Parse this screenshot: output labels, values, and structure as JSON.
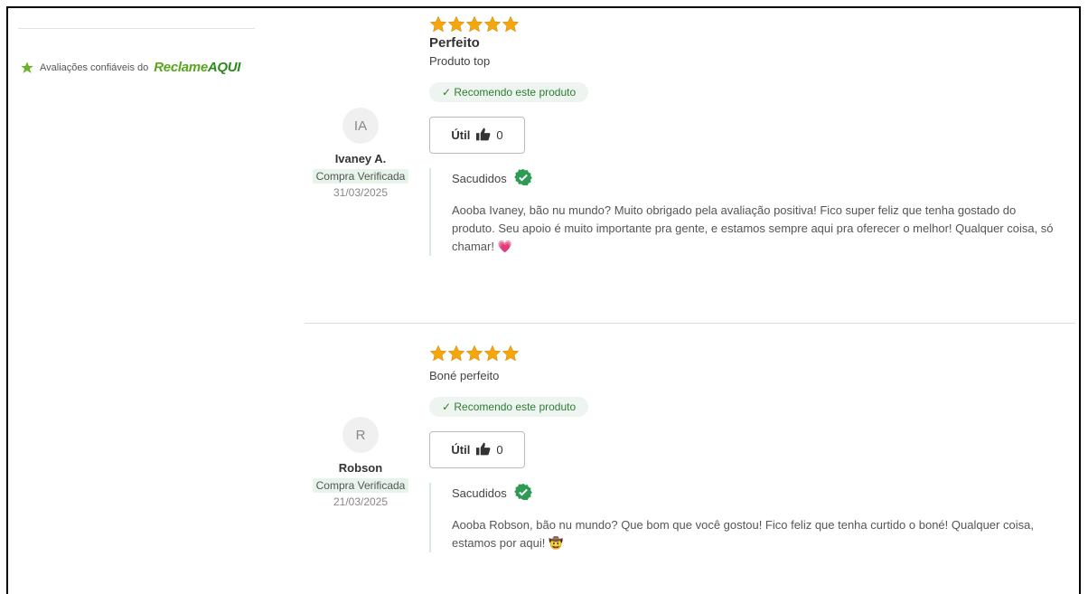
{
  "sidebar": {
    "badge_text": "Avaliações confiáveis do",
    "logo_part1": "Reclame",
    "logo_part2": "AQUI"
  },
  "colors": {
    "star": "#f4a70a",
    "recommend_green": "#2e7d32",
    "verified_bg": "#e6f4ea",
    "check_badge": "#2e9b54"
  },
  "reviews": [
    {
      "initials": "IA",
      "author": "Ivaney A.",
      "verified": "Compra Verificada",
      "date": "31/03/2025",
      "rating": 5,
      "title": "Perfeito",
      "body": "Produto top",
      "recommend": "✓ Recomendo este produto",
      "useful_label": "Útil",
      "useful_count": "0",
      "reply_author": "Sacudidos",
      "reply_text": "Aooba Ivaney, bão nu mundo? Muito obrigado pela avaliação positiva! Fico super feliz que tenha gostado do produto. Seu apoio é muito importante pra gente, e estamos sempre aqui pra oferecer o melhor! Qualquer coisa, só chamar! 💗"
    },
    {
      "initials": "R",
      "author": "Robson",
      "verified": "Compra Verificada",
      "date": "21/03/2025",
      "rating": 5,
      "title": "",
      "body": "Boné perfeito",
      "recommend": "✓ Recomendo este produto",
      "useful_label": "Útil",
      "useful_count": "0",
      "reply_author": "Sacudidos",
      "reply_text": "Aooba Robson, bão nu mundo? Que bom que você gostou! Fico feliz que tenha curtido o boné! Qualquer coisa, estamos por aqui! 🤠"
    }
  ]
}
